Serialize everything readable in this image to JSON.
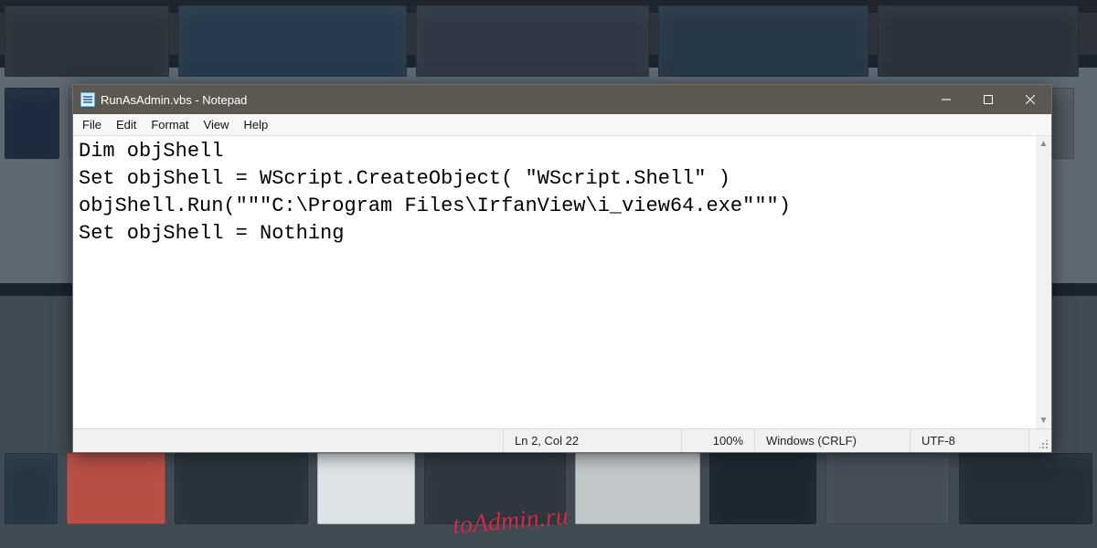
{
  "window": {
    "title": "RunAsAdmin.vbs - Notepad"
  },
  "menubar": {
    "items": [
      "File",
      "Edit",
      "Format",
      "View",
      "Help"
    ]
  },
  "editor": {
    "content": "Dim objShell\nSet objShell = WScript.CreateObject( \"WScript.Shell\" )\nobjShell.Run(\"\"\"C:\\Program Files\\IrfanView\\i_view64.exe\"\"\")\nSet objShell = Nothing"
  },
  "statusbar": {
    "position": "Ln 2, Col 22",
    "zoom": "100%",
    "line_ending": "Windows (CRLF)",
    "encoding": "UTF-8"
  },
  "watermark": "toAdmin.ru"
}
